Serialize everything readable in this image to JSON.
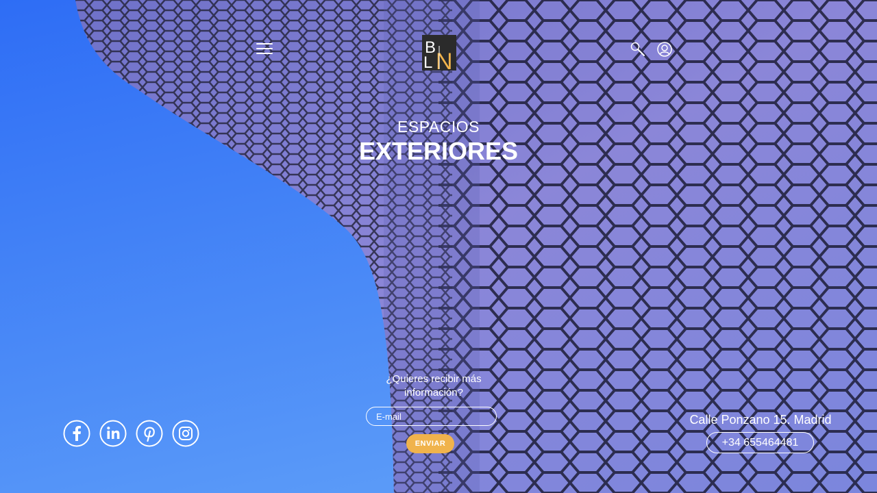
{
  "header": {
    "logo_alt": "BLN",
    "menu_icon": "hamburger-menu-icon",
    "search_icon": "search-icon",
    "account_icon": "user-account-icon"
  },
  "hero": {
    "subtitle": "ESPACIOS",
    "title": "EXTERIORES"
  },
  "newsletter": {
    "prompt": "¿Quieres recibir más información?",
    "email_placeholder": "E-mail",
    "submit_label": "ENVIAR"
  },
  "social": [
    "facebook-icon",
    "linkedin-icon",
    "pinterest-icon",
    "instagram-icon"
  ],
  "contact": {
    "address": "Calle Ponzano 15. Madrid",
    "phone": "+34 655464481"
  },
  "colors": {
    "sky": "#3f7ff7",
    "facade": "#7a7fd6",
    "accent": "#f0b34c",
    "logo_bg": "#2b2b2b"
  }
}
